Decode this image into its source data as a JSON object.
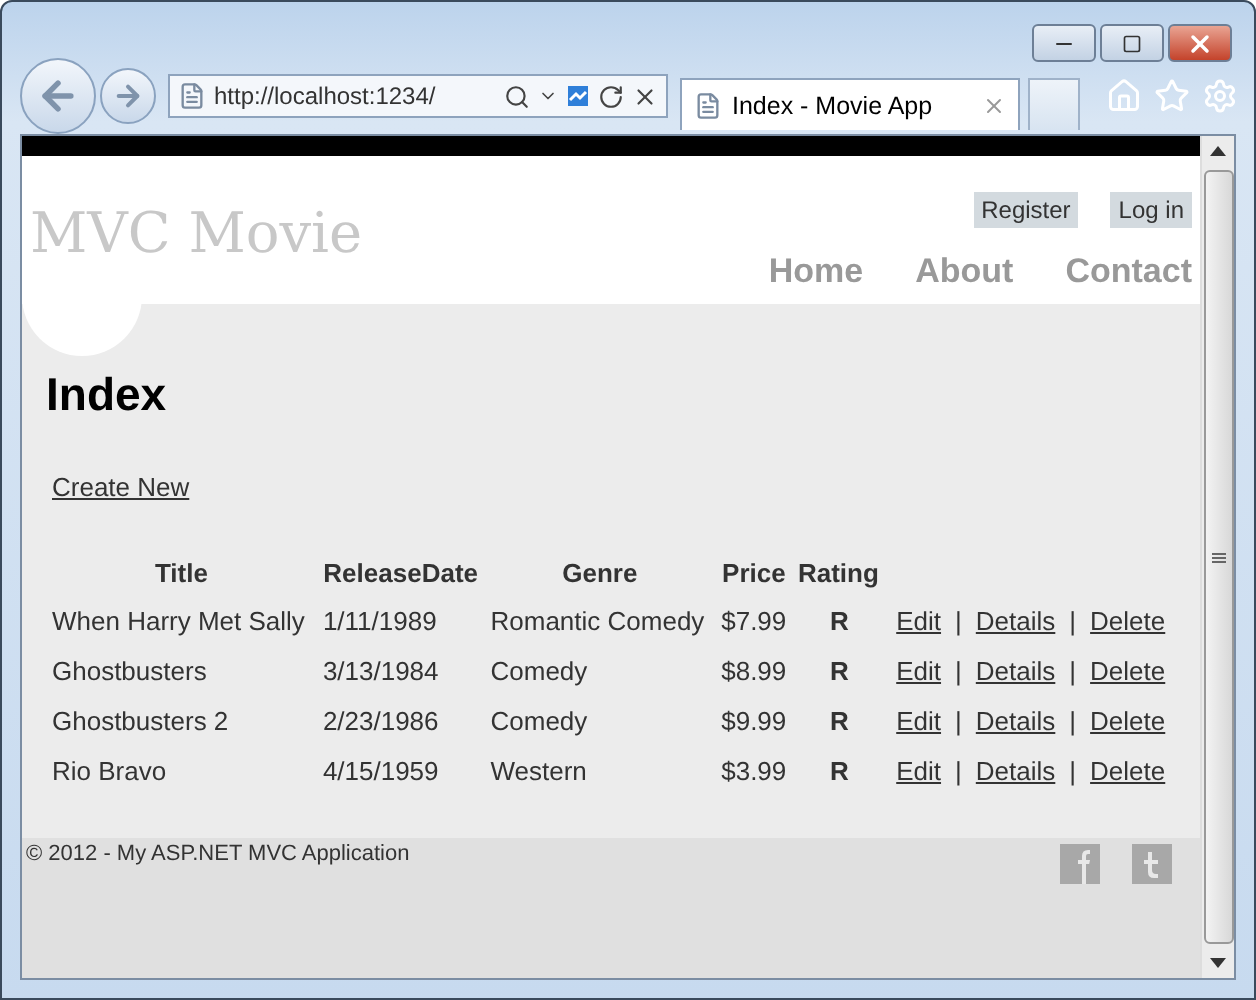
{
  "browser": {
    "address": "http://localhost:1234/",
    "tab_title": "Index - Movie App"
  },
  "site": {
    "logo": "MVC Movie",
    "auth_links": [
      "Register",
      "Log in"
    ],
    "nav": [
      "Home",
      "About",
      "Contact"
    ]
  },
  "page": {
    "heading": "Index",
    "create_link": "Create New"
  },
  "table": {
    "columns": [
      "Title",
      "ReleaseDate",
      "Genre",
      "Price",
      "Rating"
    ],
    "rows": [
      {
        "cells": [
          "When Harry Met Sally",
          "1/11/1989",
          "Romantic Comedy",
          "$7.99",
          "R"
        ],
        "actions": [
          "Edit",
          "Details",
          "Delete"
        ],
        "separators": [
          "|",
          "|"
        ]
      },
      {
        "cells": [
          "Ghostbusters",
          "3/13/1984",
          "Comedy",
          "$8.99",
          "R"
        ],
        "actions": [
          "Edit",
          "Details",
          "Delete"
        ],
        "separators": [
          "|",
          "|"
        ]
      },
      {
        "cells": [
          "Ghostbusters 2",
          "2/23/1986",
          "Comedy",
          "$9.99",
          "R"
        ],
        "actions": [
          "Edit",
          "Details",
          "Delete"
        ],
        "separators": [
          "|",
          "|"
        ]
      },
      {
        "cells": [
          "Rio Bravo",
          "4/15/1959",
          "Western",
          "$3.99",
          "R"
        ],
        "actions": [
          "Edit",
          "Details",
          "Delete"
        ],
        "separators": [
          "|",
          "|"
        ]
      }
    ]
  },
  "footer": {
    "text": "© 2012 - My ASP.NET MVC Application"
  }
}
